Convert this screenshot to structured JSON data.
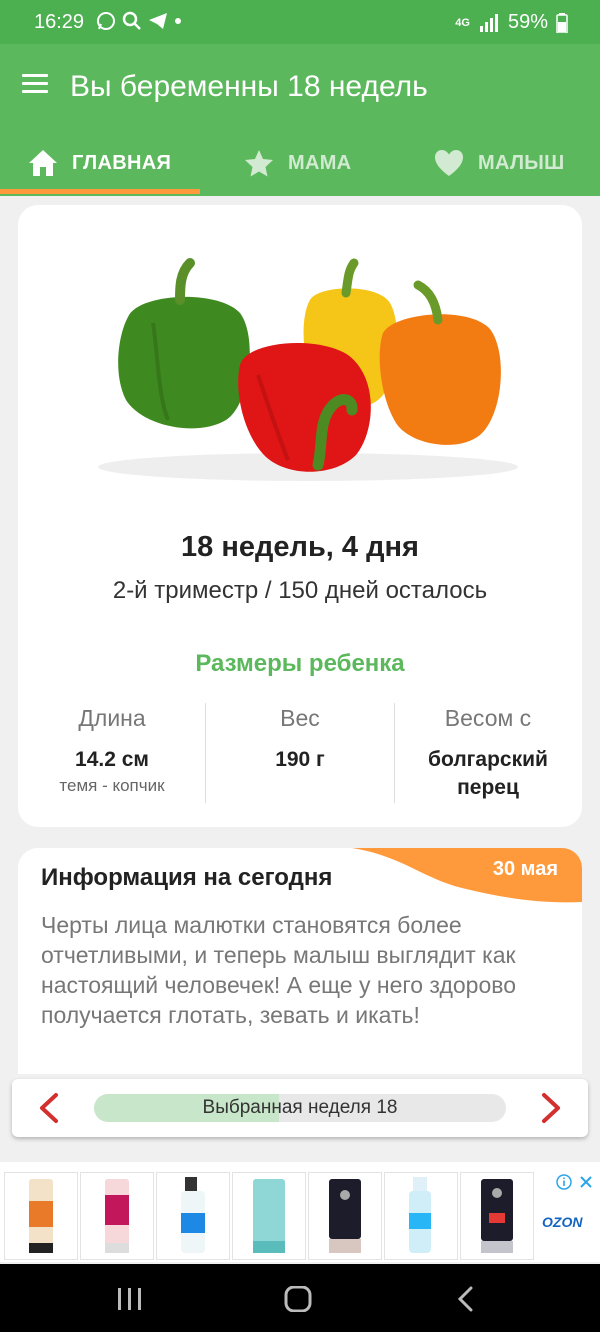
{
  "status_bar": {
    "time": "16:29",
    "battery": "59%",
    "network": "4G"
  },
  "app_bar": {
    "title": "Вы беременны 18 недель"
  },
  "tabs": [
    {
      "label": "ГЛАВНАЯ",
      "icon": "home-icon",
      "active": true
    },
    {
      "label": "МАМА",
      "icon": "star-icon",
      "active": false
    },
    {
      "label": "МАЛЫШ",
      "icon": "heart-icon",
      "active": false
    }
  ],
  "summary": {
    "week_title": "18 недель, 4 дня",
    "subtitle": "2-й триместр / 150 дней осталось",
    "sizes_title": "Размеры ребенка",
    "length": {
      "label": "Длина",
      "value": "14.2 см",
      "note": "темя - копчик"
    },
    "weight": {
      "label": "Вес",
      "value": "190 г"
    },
    "compare": {
      "label": "Весом с",
      "value": "болгарский перец"
    }
  },
  "info": {
    "title": "Информация на сегодня",
    "date": "30 мая",
    "text": "Черты лица малютки становятся более отчетливыми, и теперь малыш выглядит как настоящий человечек! А еще у него здорово получается глотать, зевать и икать!"
  },
  "week_selector": {
    "label": "Выбранная неделя 18",
    "progress": 0.45
  },
  "ad": {
    "brand": "OZON"
  },
  "colors": {
    "primary": "#5cb85c",
    "accent": "#ff9a3c",
    "arrow": "#d32f2f"
  }
}
